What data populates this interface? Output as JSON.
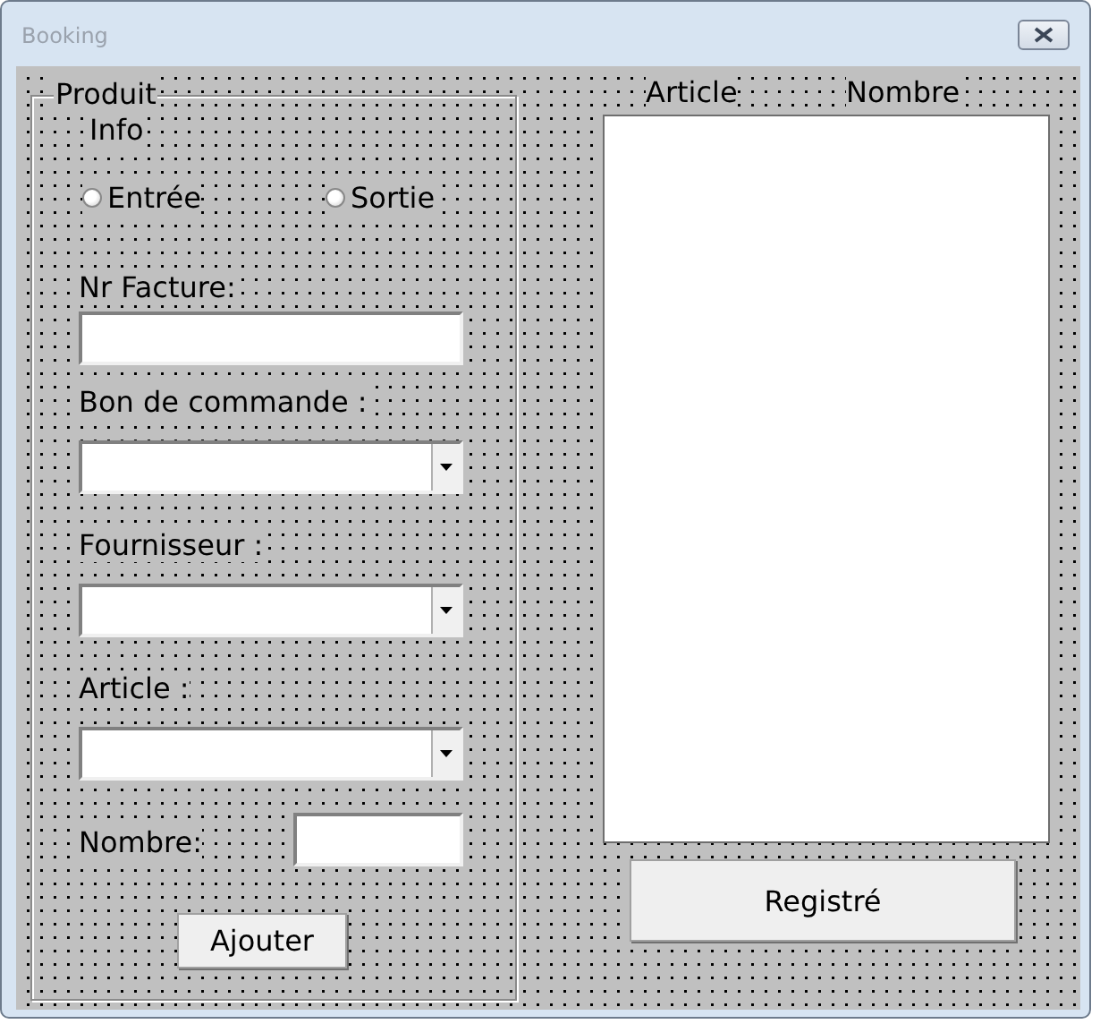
{
  "window": {
    "title": "Booking"
  },
  "frame": {
    "caption": "Produit"
  },
  "info_label": "Info",
  "radios": [
    {
      "label": "Entrée",
      "selected": false
    },
    {
      "label": "Sortie",
      "selected": false
    }
  ],
  "fields": [
    {
      "label": "Nr Facture:",
      "kind": "textbox"
    },
    {
      "label": "Bon de commande :",
      "kind": "combobox"
    },
    {
      "label": "Fournisseur :",
      "kind": "combobox"
    },
    {
      "label": "Article :",
      "kind": "combobox"
    },
    {
      "label": "Nombre:",
      "kind": "textbox"
    }
  ],
  "add_button": "Ajouter",
  "list": {
    "columns": [
      "Article",
      "Nombre"
    ]
  },
  "save_button": "Registré"
}
